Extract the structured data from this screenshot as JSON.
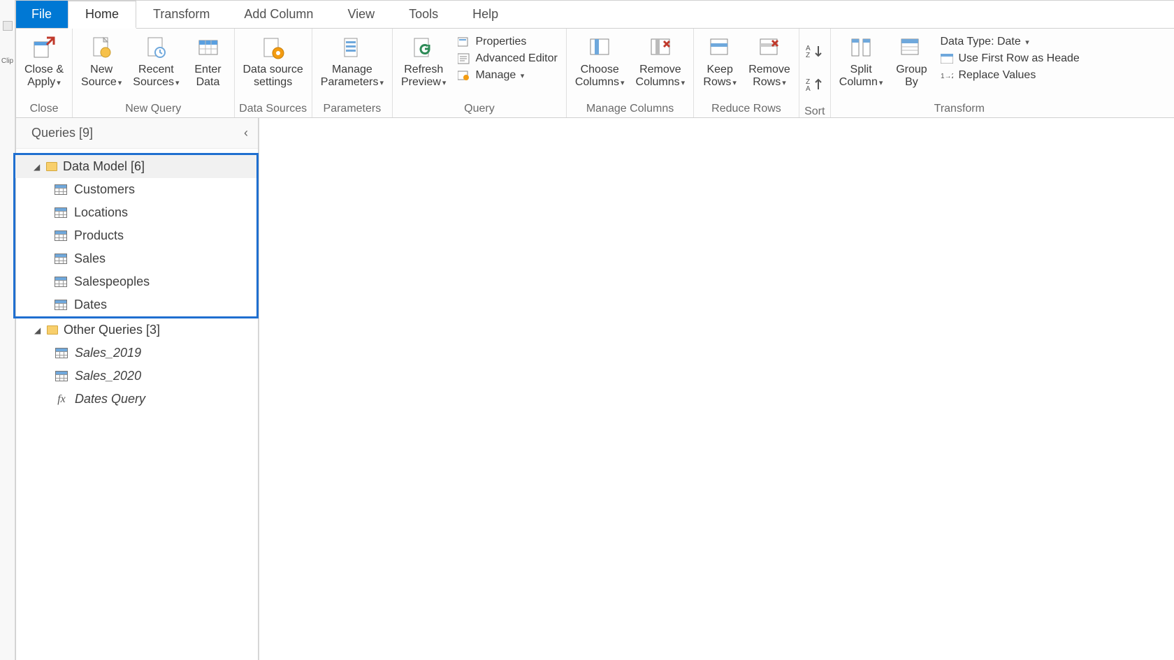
{
  "left_sliver": {
    "label": "Clip"
  },
  "tabs": {
    "file": "File",
    "home": "Home",
    "transform": "Transform",
    "add_column": "Add Column",
    "view": "View",
    "tools": "Tools",
    "help": "Help"
  },
  "ribbon": {
    "close": {
      "button": "Close &\nApply",
      "group": "Close"
    },
    "new_query": {
      "new_source": "New\nSource",
      "recent_sources": "Recent\nSources",
      "enter_data": "Enter\nData",
      "group": "New Query"
    },
    "data_sources": {
      "settings": "Data source\nsettings",
      "group": "Data Sources"
    },
    "parameters": {
      "manage": "Manage\nParameters",
      "group": "Parameters"
    },
    "query": {
      "refresh": "Refresh\nPreview",
      "properties": "Properties",
      "advanced_editor": "Advanced Editor",
      "manage": "Manage",
      "group": "Query"
    },
    "manage_columns": {
      "choose": "Choose\nColumns",
      "remove": "Remove\nColumns",
      "group": "Manage Columns"
    },
    "reduce_rows": {
      "keep": "Keep\nRows",
      "remove": "Remove\nRows",
      "group": "Reduce Rows"
    },
    "sort": {
      "group": "Sort"
    },
    "transform_group": {
      "split": "Split\nColumn",
      "group_by": "Group\nBy",
      "data_type": "Data Type: Date",
      "first_row": "Use First Row as Heade",
      "replace": "Replace Values",
      "group": "Transform"
    }
  },
  "queries_pane": {
    "header": "Queries [9]",
    "folders": [
      {
        "name": "Data Model [6]",
        "highlighted": true,
        "items": [
          {
            "label": "Customers",
            "type": "table"
          },
          {
            "label": "Locations",
            "type": "table"
          },
          {
            "label": "Products",
            "type": "table"
          },
          {
            "label": "Sales",
            "type": "table"
          },
          {
            "label": "Salespeoples",
            "type": "table"
          },
          {
            "label": "Dates",
            "type": "table"
          }
        ]
      },
      {
        "name": "Other Queries [3]",
        "highlighted": false,
        "items": [
          {
            "label": "Sales_2019",
            "type": "table",
            "italic": true
          },
          {
            "label": "Sales_2020",
            "type": "table",
            "italic": true
          },
          {
            "label": "Dates Query",
            "type": "fx",
            "italic": true
          }
        ]
      }
    ]
  }
}
